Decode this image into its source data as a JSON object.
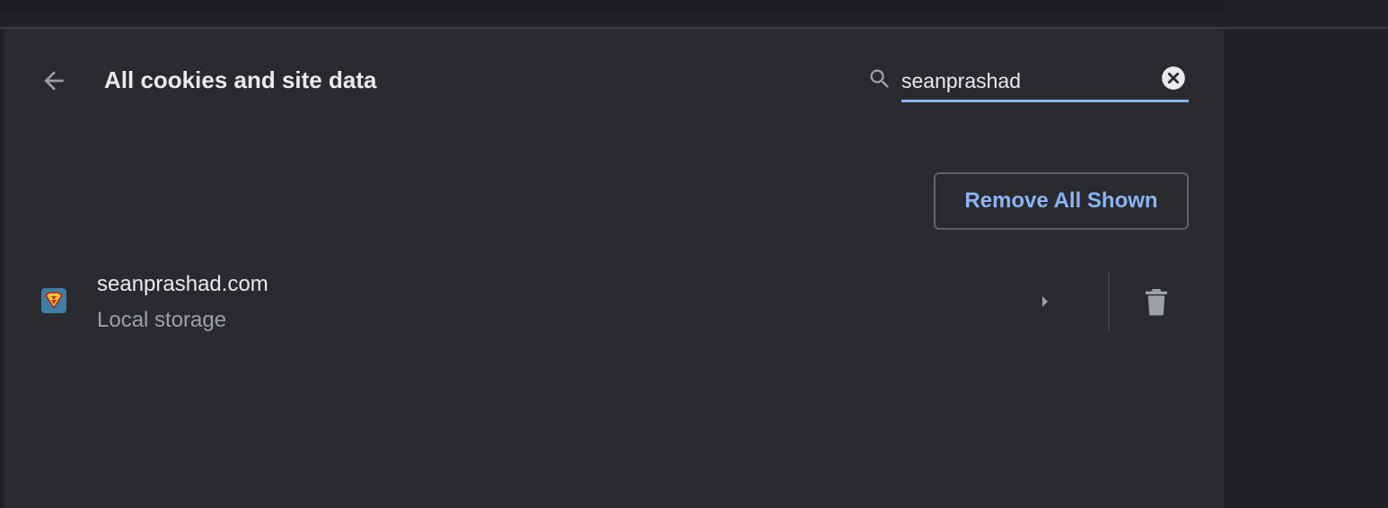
{
  "header": {
    "title": "All cookies and site data",
    "back_icon": "arrow-back-icon"
  },
  "search": {
    "value": "seanprashad",
    "icon": "search-icon",
    "clear_icon": "clear-icon"
  },
  "actions": {
    "remove_all_label": "Remove All Shown"
  },
  "sites": [
    {
      "name": "seanprashad.com",
      "detail": "Local storage",
      "favicon": "superman-favicon",
      "expand_icon": "arrow-right-icon",
      "delete_icon": "trash-icon"
    }
  ],
  "colors": {
    "background": "#202124",
    "card": "#292a2d",
    "text_primary": "#e8eaed",
    "text_secondary": "#9aa0a6",
    "accent": "#8ab4f8",
    "icon": "#9aa0a6"
  }
}
